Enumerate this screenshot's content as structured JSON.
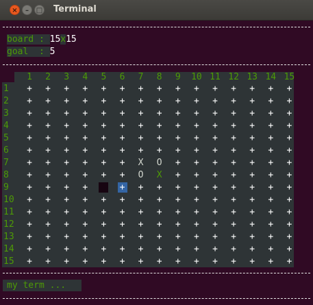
{
  "window": {
    "title": "Terminal",
    "close_glyph": "×",
    "min_glyph": "–",
    "max_glyph": "□"
  },
  "info": {
    "board_label": "board : ",
    "board_w": "15",
    "board_sep": "x",
    "board_h": "15",
    "goal_label": "goal  : ",
    "goal_value": "5"
  },
  "board": {
    "columns": [
      "1",
      "2",
      "3",
      "4",
      "5",
      "6",
      "7",
      "8",
      "9",
      "10",
      "11",
      "12",
      "13",
      "14",
      "15"
    ],
    "rows": [
      "1",
      "2",
      "3",
      "4",
      "5",
      "6",
      "7",
      "8",
      "9",
      "10",
      "11",
      "12",
      "13",
      "14",
      "15"
    ],
    "empty": "+",
    "stones": [
      {
        "row": 7,
        "col": 7,
        "mark": "X",
        "style": "x"
      },
      {
        "row": 7,
        "col": 8,
        "mark": "O",
        "style": "o"
      },
      {
        "row": 8,
        "col": 7,
        "mark": "O",
        "style": "o"
      },
      {
        "row": 8,
        "col": 8,
        "mark": "X",
        "style": "xg"
      }
    ],
    "cursor": {
      "row": 9,
      "col": 6,
      "mark": "+"
    },
    "previous": {
      "row": 9,
      "col": 5,
      "mark": ""
    }
  },
  "prompt": {
    "text": "my term ..."
  },
  "colors": {
    "background": "#300a24",
    "label_green": "#4e9a06",
    "board_bg": "#2e3436",
    "cursor_blue": "#3465a4"
  }
}
